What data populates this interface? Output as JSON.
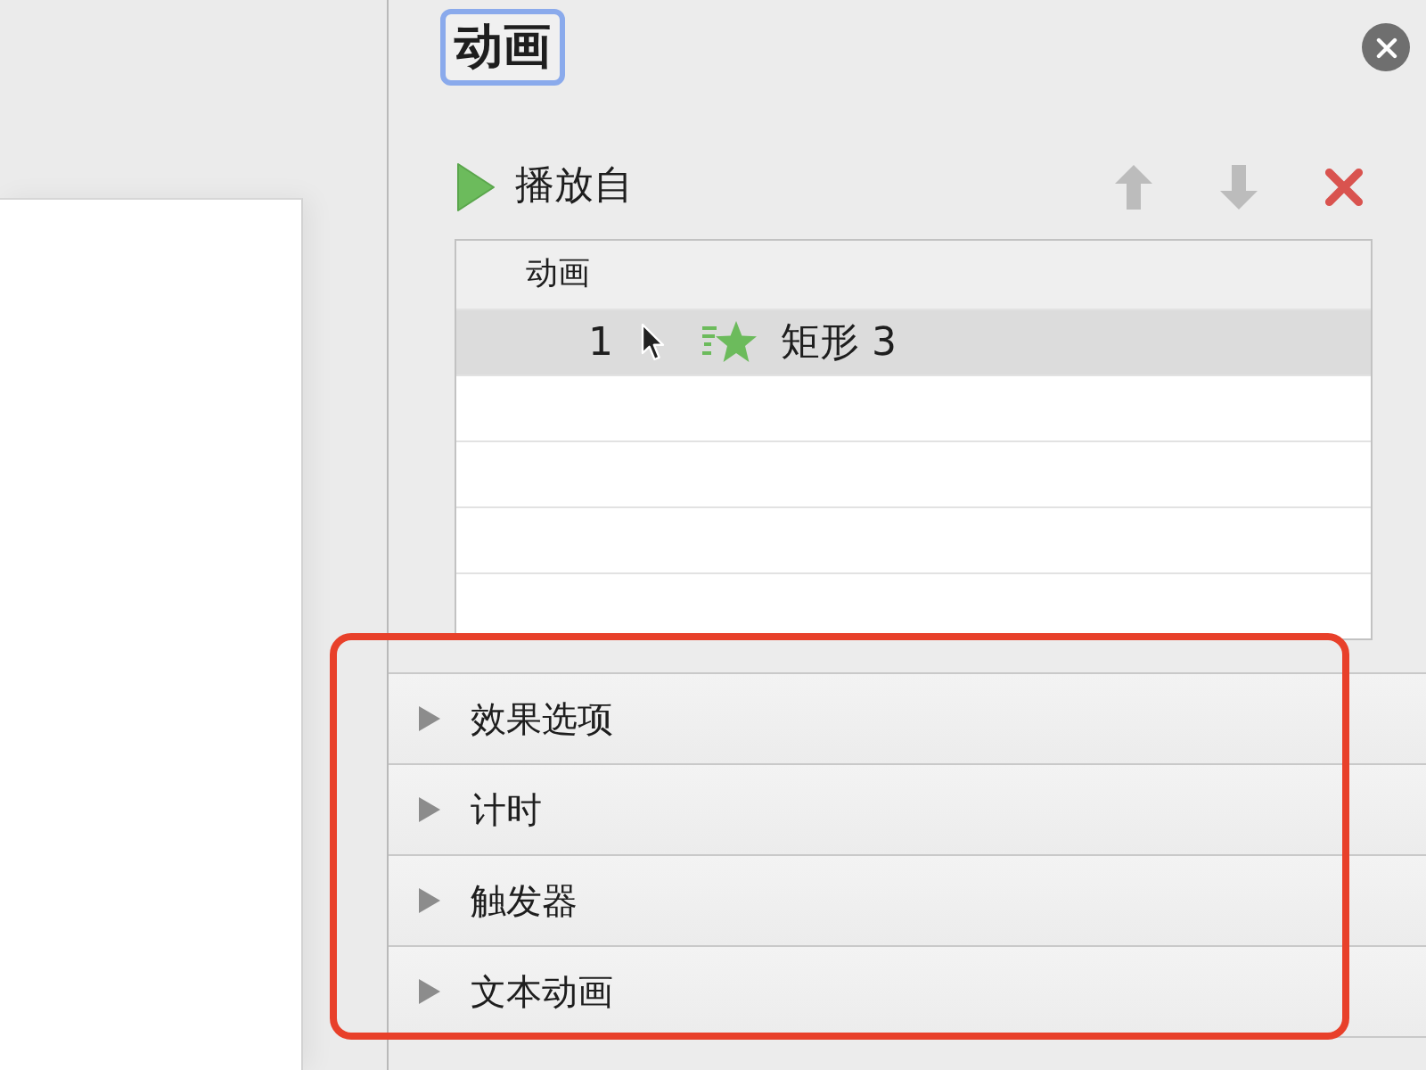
{
  "pane": {
    "title": "动画",
    "title_focused": true
  },
  "play_from": {
    "label": "播放自"
  },
  "toolbar": [
    {
      "kind": "up",
      "disabled": true
    },
    {
      "kind": "down",
      "disabled": true
    },
    {
      "kind": "remove",
      "disabled": false
    }
  ],
  "list": {
    "column": "动画",
    "rows": [
      {
        "order": "1",
        "name": "矩形 3",
        "kind": "entrance",
        "selected": true
      }
    ]
  },
  "sections": [
    {
      "label": "效果选项",
      "expanded": false
    },
    {
      "label": "计时",
      "expanded": false
    },
    {
      "label": "触发器",
      "expanded": false
    },
    {
      "label": "文本动画",
      "expanded": false
    }
  ],
  "annotation": {
    "kind": "frame"
  }
}
